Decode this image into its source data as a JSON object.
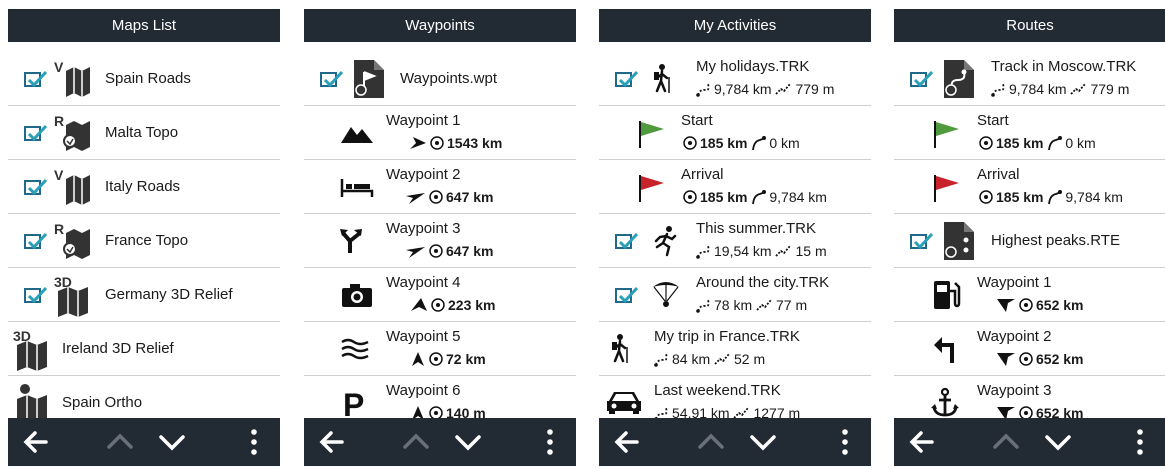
{
  "screens": {
    "maps": {
      "title": "Maps List",
      "items": [
        {
          "label": "Spain Roads",
          "badge": "V",
          "checked": true
        },
        {
          "label": "Malta Topo",
          "badge": "R",
          "checked": true
        },
        {
          "label": "Italy Roads",
          "badge": "V",
          "checked": true
        },
        {
          "label": "France Topo",
          "badge": "R",
          "checked": true
        },
        {
          "label": "Germany 3D Relief",
          "badge": "3D",
          "checked": true
        },
        {
          "label": "Ireland 3D Relief",
          "badge": "3D",
          "checked": false
        },
        {
          "label": "Spain Ortho",
          "badge": "",
          "checked": false
        }
      ]
    },
    "waypoints": {
      "title": "Waypoints",
      "file": {
        "label": "Waypoints.wpt",
        "checked": true
      },
      "items": [
        {
          "name": "Waypoint 1",
          "dist": "1543 km",
          "icon": "mountain-icon"
        },
        {
          "name": "Waypoint 2",
          "dist": "647 km",
          "icon": "bed-icon"
        },
        {
          "name": "Waypoint 3",
          "dist": "647 km",
          "icon": "junction-icon"
        },
        {
          "name": "Waypoint 4",
          "dist": "223 km",
          "icon": "camera-icon"
        },
        {
          "name": "Waypoint 5",
          "dist": "72 km",
          "icon": "water-icon"
        },
        {
          "name": "Waypoint 6",
          "dist": "140 m",
          "icon": "parking-icon"
        }
      ]
    },
    "activities": {
      "title": "My Activities",
      "items": [
        {
          "name": "My holidays.TRK",
          "dist": "9,784 km",
          "elev": "779 m",
          "checked": true,
          "icon": "hiker-icon"
        },
        {
          "name": "Start",
          "dist": "185 km",
          "elev": "0 km",
          "icon": "green-flag-icon"
        },
        {
          "name": "Arrival",
          "dist": "185 km",
          "elev": "9,784 km",
          "icon": "red-flag-icon"
        },
        {
          "name": "This summer.TRK",
          "dist": "19,54 km",
          "elev": "15 m",
          "checked": true,
          "icon": "runner-icon"
        },
        {
          "name": "Around the city.TRK",
          "dist": "78 km",
          "elev": "77 m",
          "checked": true,
          "icon": "paraglider-icon"
        },
        {
          "name": "My trip in France.TRK",
          "dist": "84 km",
          "elev": "52 m",
          "icon": "hiker-icon"
        },
        {
          "name": "Last weekend.TRK",
          "dist": "54,91 km",
          "elev": "1277 m",
          "icon": "car-icon"
        }
      ]
    },
    "routes": {
      "title": "Routes",
      "items": [
        {
          "name": "Track in Moscow.TRK",
          "dist": "9,784 km",
          "elev": "779 m",
          "checked": true,
          "icon": "route-file-icon"
        },
        {
          "name": "Start",
          "dist": "185 km",
          "elev": "0 km",
          "icon": "green-flag-icon"
        },
        {
          "name": "Arrival",
          "dist": "185 km",
          "elev": "9,784 km",
          "icon": "red-flag-icon"
        },
        {
          "name": "Highest peaks.RTE",
          "checked": true,
          "icon": "route-points-icon"
        },
        {
          "name": "Waypoint 1",
          "dist": "652 km",
          "icon": "fuel-icon"
        },
        {
          "name": "Waypoint 2",
          "dist": "652 km",
          "icon": "turn-left-icon"
        },
        {
          "name": "Waypoint 3",
          "dist": "652 km",
          "icon": "anchor-icon"
        }
      ]
    }
  },
  "colors": {
    "header": "#222a33",
    "check": "#1f6a8a",
    "green_flag": "#4e9a3c",
    "red_flag": "#c8222a"
  }
}
